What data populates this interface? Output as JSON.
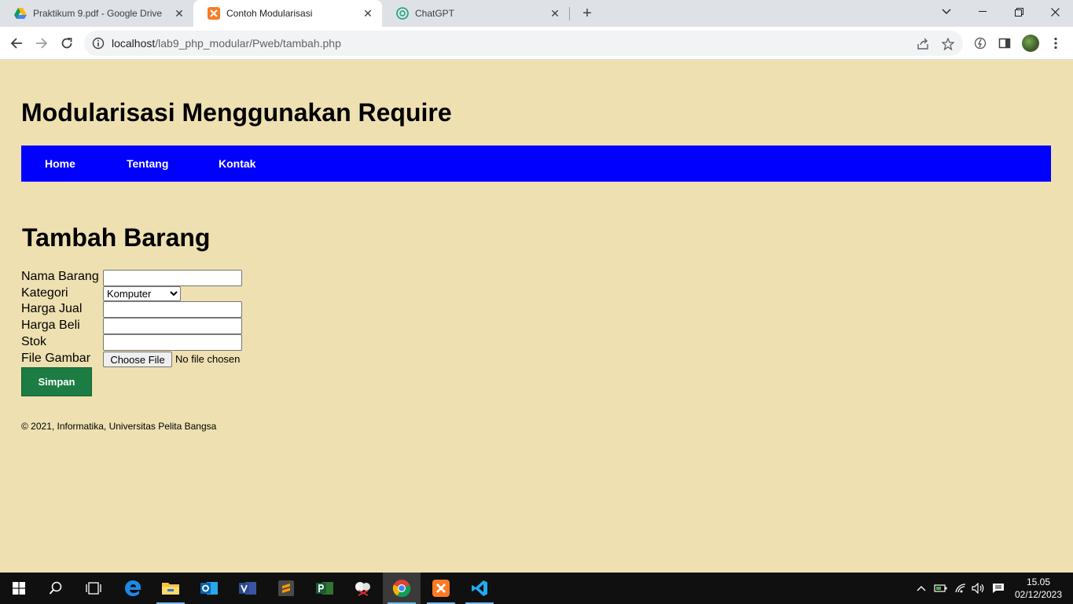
{
  "browser": {
    "tabs": [
      {
        "title": "Praktikum 9.pdf - Google Drive",
        "icon": "google-drive-icon",
        "active": false
      },
      {
        "title": "Contoh Modularisasi",
        "icon": "xampp-icon",
        "active": true
      },
      {
        "title": "ChatGPT",
        "icon": "chatgpt-icon",
        "active": false
      }
    ],
    "url_host": "localhost",
    "url_path": "/lab9_php_modular/Pweb/tambah.php"
  },
  "site": {
    "title": "Modularisasi Menggunakan Require",
    "nav": [
      "Home",
      "Tentang",
      "Kontak"
    ],
    "nav_color": "#0000ff",
    "background": "#eee0b1"
  },
  "form": {
    "heading": "Tambah Barang",
    "labels": {
      "nama": "Nama Barang",
      "kategori": "Kategori",
      "harga_jual": "Harga Jual",
      "harga_beli": "Harga Beli",
      "stok": "Stok",
      "gambar": "File Gambar"
    },
    "values": {
      "nama": "",
      "harga_jual": "",
      "harga_beli": "",
      "stok": ""
    },
    "kategori_selected": "Komputer",
    "file_button": "Choose File",
    "file_status": "No file chosen",
    "submit_label": "Simpan",
    "submit_color": "#1c7c44"
  },
  "footer": {
    "text": "© 2021, Informatika, Universitas Pelita Bangsa"
  },
  "taskbar": {
    "apps": [
      "windows-start-icon",
      "search-icon",
      "task-view-icon",
      "edge-icon",
      "file-explorer-icon",
      "outlook-icon",
      "visio-icon",
      "sublime-text-icon",
      "project-icon",
      "snipping-tool-icon",
      "chrome-icon",
      "xampp-icon",
      "vscode-icon"
    ],
    "time": "15.05",
    "date": "02/12/2023"
  }
}
